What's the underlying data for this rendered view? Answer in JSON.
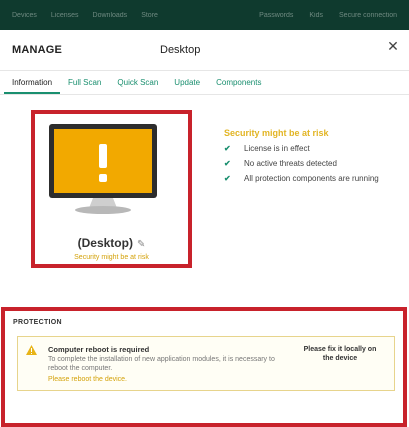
{
  "topnav": {
    "left": [
      "Devices",
      "Licenses",
      "Downloads",
      "Store"
    ],
    "right": [
      "Passwords",
      "Kids",
      "Secure connection"
    ]
  },
  "header": {
    "section": "MANAGE",
    "title": "Desktop",
    "close_glyph": "✕"
  },
  "tabs": [
    "Information",
    "Full Scan",
    "Quick Scan",
    "Update",
    "Components"
  ],
  "device": {
    "name": "(Desktop)",
    "status": "Security might be at risk",
    "screen_color": "#f2a900",
    "icon": "monitor-warning-icon"
  },
  "risk": {
    "title": "Security might be at risk",
    "title_color": "#e2b524",
    "items": [
      "License is in effect",
      "No active threats detected",
      "All protection components are running"
    ]
  },
  "protection": {
    "label": "PROTECTION",
    "alert": {
      "heading": "Computer reboot is required",
      "description": "To complete the installation of new application modules, it is necessary to reboot the computer.",
      "link": "Please reboot the device.",
      "fix": "Please fix it locally on the device"
    }
  },
  "colors": {
    "accent": "#1a8f6f",
    "highlight_border": "#c8222b",
    "warning": "#d4a20a",
    "nav_bg": "#0f3a2e"
  }
}
